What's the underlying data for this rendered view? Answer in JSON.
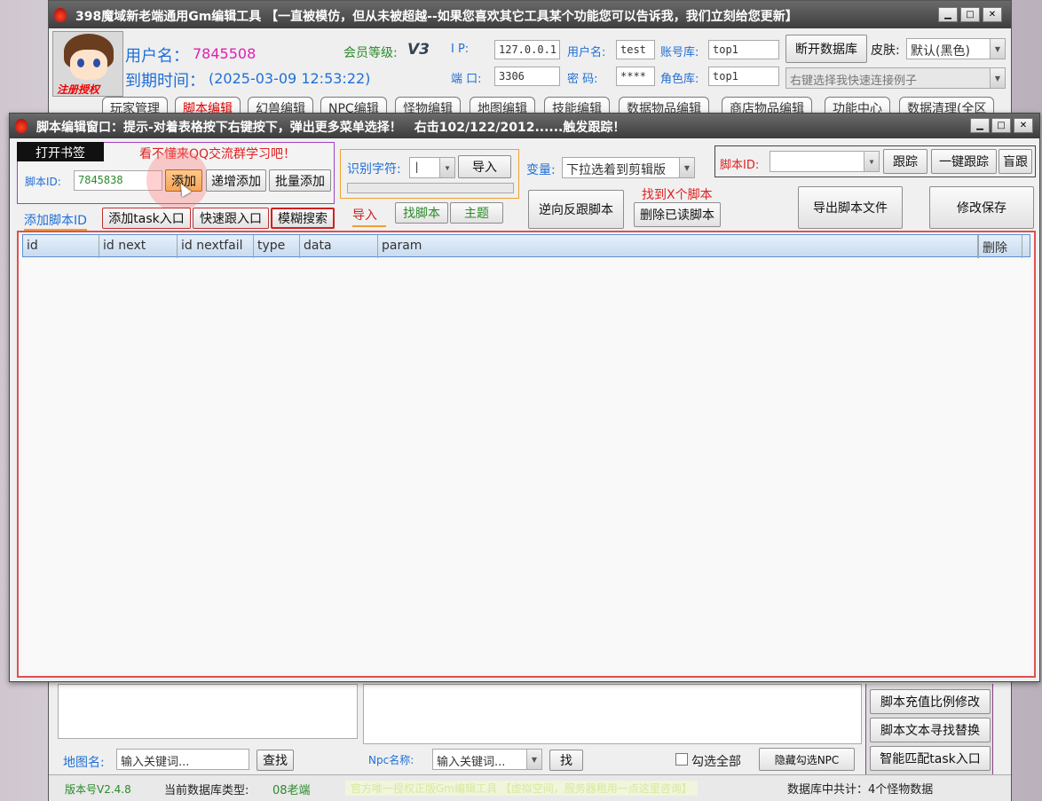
{
  "main_window": {
    "title": "398魔域新老端通用Gm编辑工具 【一直被模仿，但从未被超越--如果您喜欢其它工具某个功能您可以告诉我，我们立刻给您更新】",
    "avatar_caption": "注册授权",
    "username_label": "用户名：",
    "username_value": "7845508",
    "expire_label": "到期时间：",
    "expire_value": "(2025-03-09 12:53:22)",
    "member_level_label": "会员等级:",
    "member_level_badge": "V3",
    "ip_label": "I P:",
    "ip_value": "127.0.0.1",
    "port_label": "端 口:",
    "port_value": "3306",
    "db_user_label": "用户名:",
    "db_user_value": "test",
    "password_label": "密 码:",
    "password_value": "****",
    "account_db_label": "账号库:",
    "account_db_value": "top1",
    "role_db_label": "角色库:",
    "role_db_value": "top1",
    "disconnect_button": "断开数据库",
    "skin_label": "皮肤:",
    "skin_value": "默认(黑色)",
    "connect_example_placeholder": "右键选择我快速连接例子",
    "tabs": [
      "玩家管理",
      "脚本编辑",
      "幻兽编辑",
      "NPC编辑",
      "怪物编辑",
      "地图编辑",
      "技能编辑",
      "数据物品编辑",
      "商店物品编辑",
      "功能中心",
      "数据清理(全区"
    ]
  },
  "bottom": {
    "map_name_label": "地图名:",
    "map_name_placeholder": "输入关键词...",
    "map_search_button": "查找",
    "npc_name_label": "Npc名称:",
    "npc_name_placeholder": "输入关键词...",
    "npc_find_button": "找",
    "select_all_label": "勾选全部",
    "hide_npc_button": "隐藏勾选NPC",
    "right_buttons": [
      "脚本充值比例修改",
      "脚本文本寻找替换",
      "智能匹配task入口"
    ],
    "status_version": "版本号V2.4.8",
    "status_db_type_label": "当前数据库类型:",
    "status_db_type_value": "08老端",
    "status_promo": "官方唯一授权正版Gm编辑工具 【虚拟空间，服务器租用一点这里咨询】",
    "status_count": "数据库中共计：4个怪物数据"
  },
  "script_window": {
    "title": "脚本编辑窗口：提示-对着表格按下右键按下，弹出更多菜单选择！　右击102/122/2012......触发跟踪！",
    "bookmark_button": "打开书签",
    "qq_hint": "看不懂来QQ交流群学习吧！",
    "script_id_label": "脚本ID:",
    "script_id_value": "7845838",
    "add_button": "添加",
    "increment_add_button": "递增添加",
    "batch_add_button": "批量添加",
    "sub_tabs": [
      "添加脚本ID",
      "添加task入口",
      "快速跟入口",
      "模糊搜索"
    ],
    "recognize_label": "识别字符:",
    "recognize_value": "|",
    "import_button": "导入",
    "link_tabs": [
      "导入",
      "找脚本",
      "主题"
    ],
    "variable_label": "变量:",
    "variable_value": "下拉选着到剪辑版",
    "reverse_trace_button": "逆向反跟脚本",
    "found_hint": "找到X个脚本",
    "delete_read_button": "删除已读脚本",
    "trace_id_label": "脚本ID:",
    "trace_button": "跟踪",
    "one_key_trace_button": "一键跟踪",
    "blind_trace_button": "盲跟",
    "export_button": "导出脚本文件",
    "save_button": "修改保存",
    "table_columns": [
      "id",
      "id next",
      "id nextfail",
      "type",
      "data",
      "param",
      "删除"
    ]
  }
}
